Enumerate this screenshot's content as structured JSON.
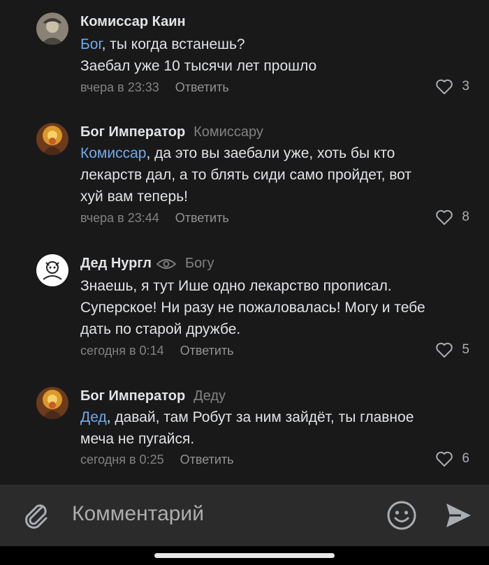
{
  "comments": [
    {
      "author": "Комиссар Каин",
      "reply_to": "",
      "text_lines": [
        [
          {
            "t": "Бог",
            "m": true
          },
          {
            "t": ", ты когда встанешь?",
            "m": false
          }
        ],
        [
          {
            "t": "Заебал уже 10 тысячи лет прошло",
            "m": false
          }
        ]
      ],
      "time": "вчера в 23:33",
      "reply_label": "Ответить",
      "likes": "3"
    },
    {
      "author": "Бог Император",
      "reply_to": "Комиссару",
      "text_lines": [
        [
          {
            "t": "Комиссар",
            "m": true
          },
          {
            "t": ", да это вы заебали уже, хоть бы кто",
            "m": false
          }
        ],
        [
          {
            "t": "лекарств дал, а то блять сиди само пройдет, вот",
            "m": false
          }
        ],
        [
          {
            "t": "хуй вам теперь!",
            "m": false
          }
        ]
      ],
      "time": "вчера в 23:44",
      "reply_label": "Ответить",
      "likes": "8"
    },
    {
      "author": "Дед Нургл",
      "reply_to": "Богу",
      "text_lines": [
        [
          {
            "t": "Знаешь, я тут Ише одно лекарство прописал.",
            "m": false
          }
        ],
        [
          {
            "t": "Суперское! Ни разу не пожаловалась! Могу и тебе",
            "m": false
          }
        ],
        [
          {
            "t": "дать по старой дружбе.",
            "m": false
          }
        ]
      ],
      "time": "сегодня в 0:14",
      "reply_label": "Ответить",
      "likes": "5"
    },
    {
      "author": "Бог Император",
      "reply_to": "Деду",
      "text_lines": [
        [
          {
            "t": "Дед",
            "m": true
          },
          {
            "t": ", давай, там Робут за ним зайдёт, ты главное",
            "m": false
          }
        ],
        [
          {
            "t": "меча не пугайся.",
            "m": false
          }
        ]
      ],
      "time": "сегодня в 0:25",
      "reply_label": "Ответить",
      "likes": "6"
    }
  ],
  "composer": {
    "placeholder": "Комментарий",
    "attach_icon": "paperclip-icon",
    "emoji_icon": "smiley-icon",
    "send_icon": "send-icon"
  },
  "colors": {
    "background": "#19191a",
    "mention": "#71aaeb",
    "meta": "#828282",
    "composer_bg": "#2b2b2c"
  }
}
